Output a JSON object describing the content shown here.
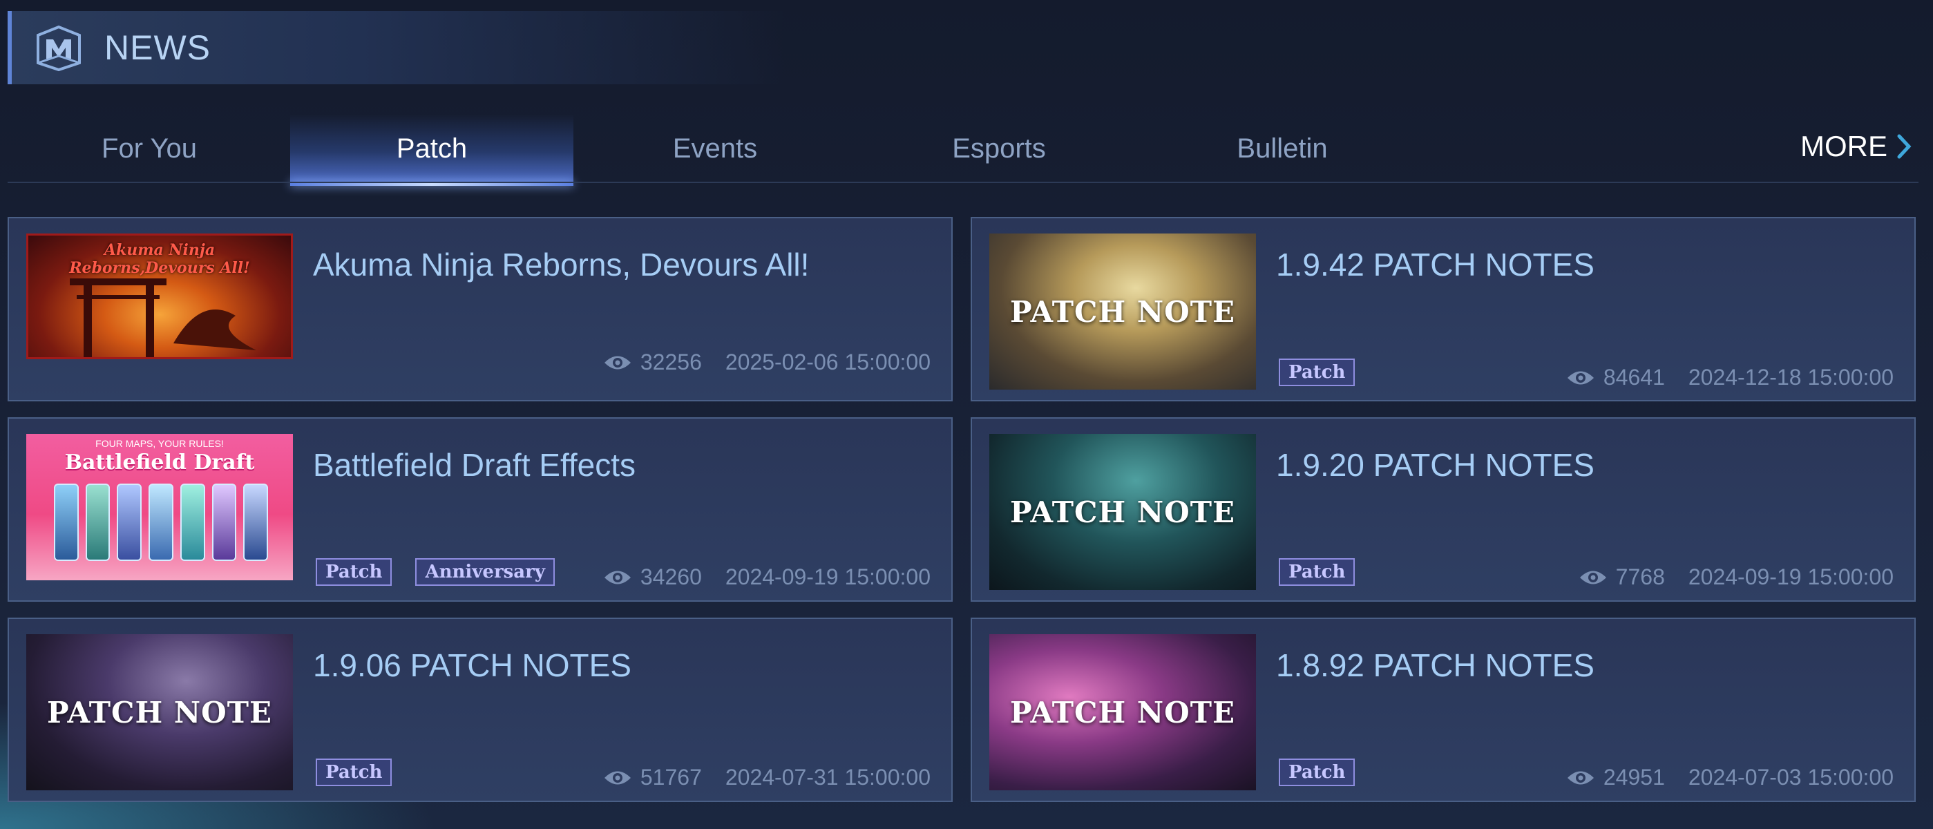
{
  "header": {
    "title": "NEWS",
    "logo_icon": "game-logo-icon"
  },
  "tabs": [
    {
      "label": "For You",
      "active": false
    },
    {
      "label": "Patch",
      "active": true
    },
    {
      "label": "Events",
      "active": false
    },
    {
      "label": "Esports",
      "active": false
    },
    {
      "label": "Bulletin",
      "active": false
    }
  ],
  "more": {
    "label": "MORE",
    "icon": "chevron-right-icon"
  },
  "colors": {
    "accent": "#5f84d6",
    "title_text": "#a6cdf5",
    "tag_border": "#8f8ee0",
    "meta_text": "#7b8fb2"
  },
  "articles": [
    {
      "title": "Akuma Ninja Reborns, Devours All!",
      "thumb_text": "Akuma Ninja Reborns,Devours All!",
      "tags": [],
      "views": "32256",
      "date": "2025-02-06 15:00:00"
    },
    {
      "title": "1.9.42 PATCH NOTES",
      "thumb_text": "PATCH NOTE",
      "tags": [
        "Patch"
      ],
      "views": "84641",
      "date": "2024-12-18 15:00:00"
    },
    {
      "title": "Battlefield Draft Effects",
      "thumb_text": "Battlefield Draft",
      "thumb_subtext": "FOUR MAPS, YOUR RULES!",
      "tags": [
        "Patch",
        "Anniversary"
      ],
      "views": "34260",
      "date": "2024-09-19 15:00:00"
    },
    {
      "title": "1.9.20 PATCH NOTES",
      "thumb_text": "PATCH NOTE",
      "tags": [
        "Patch"
      ],
      "views": "7768",
      "date": "2024-09-19 15:00:00"
    },
    {
      "title": "1.9.06 PATCH NOTES",
      "thumb_text": "PATCH NOTE",
      "tags": [
        "Patch"
      ],
      "views": "51767",
      "date": "2024-07-31 15:00:00"
    },
    {
      "title": "1.8.92 PATCH NOTES",
      "thumb_text": "PATCH NOTE",
      "tags": [
        "Patch"
      ],
      "views": "24951",
      "date": "2024-07-03 15:00:00"
    }
  ]
}
